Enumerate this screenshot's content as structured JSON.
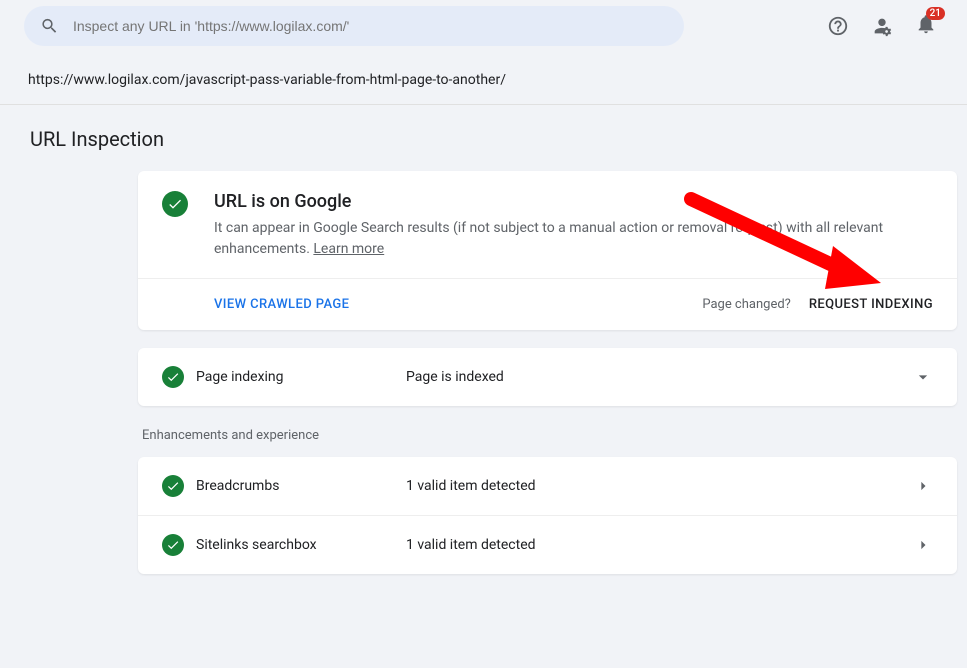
{
  "search": {
    "placeholder": "Inspect any URL in 'https://www.logilax.com/'"
  },
  "notifications": {
    "count": "21"
  },
  "inspected_url": "https://www.logilax.com/javascript-pass-variable-from-html-page-to-another/",
  "section_title": "URL Inspection",
  "status_card": {
    "title": "URL is on Google",
    "description_pre": "It can appear in Google Search results (if not subject to a manual action or removal request) with all relevant enhancements. ",
    "learn_more": "Learn more",
    "view_crawled": "VIEW CRAWLED PAGE",
    "page_changed": "Page changed?",
    "request_indexing": "REQUEST INDEXING"
  },
  "indexing_row": {
    "label": "Page indexing",
    "value": "Page is indexed"
  },
  "enhancements_header": "Enhancements and experience",
  "enhancements": [
    {
      "label": "Breadcrumbs",
      "value": "1 valid item detected"
    },
    {
      "label": "Sitelinks searchbox",
      "value": "1 valid item detected"
    }
  ]
}
